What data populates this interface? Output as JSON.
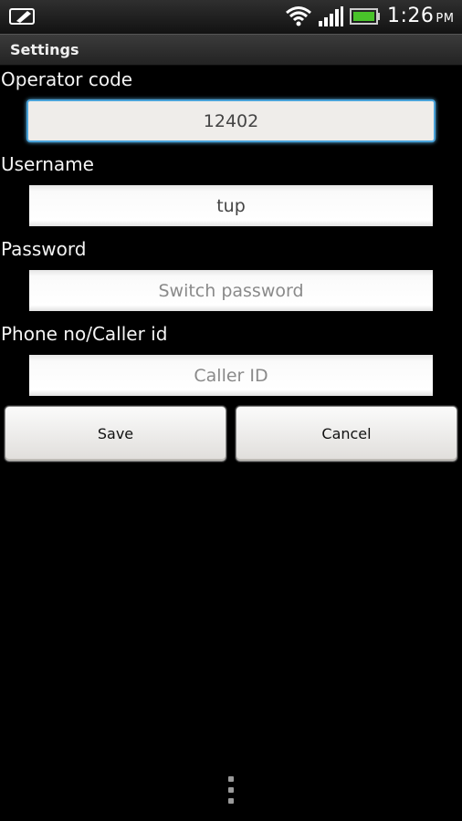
{
  "status_bar": {
    "time": "1:26",
    "ampm": "PM",
    "icons": [
      "edit-note-icon",
      "wifi-icon",
      "signal-icon",
      "battery-icon"
    ],
    "battery_color": "#49c32a"
  },
  "title": "Settings",
  "form": {
    "operator_label": "Operator code",
    "operator_value": "12402",
    "username_label": "Username",
    "username_value": "tup",
    "password_label": "Password",
    "password_placeholder": "Switch password",
    "phone_label": "Phone no/Caller id",
    "phone_placeholder": "Caller ID"
  },
  "buttons": {
    "save": "Save",
    "cancel": "Cancel"
  },
  "colors": {
    "focus": "#4aa3d9",
    "background": "#000000"
  }
}
